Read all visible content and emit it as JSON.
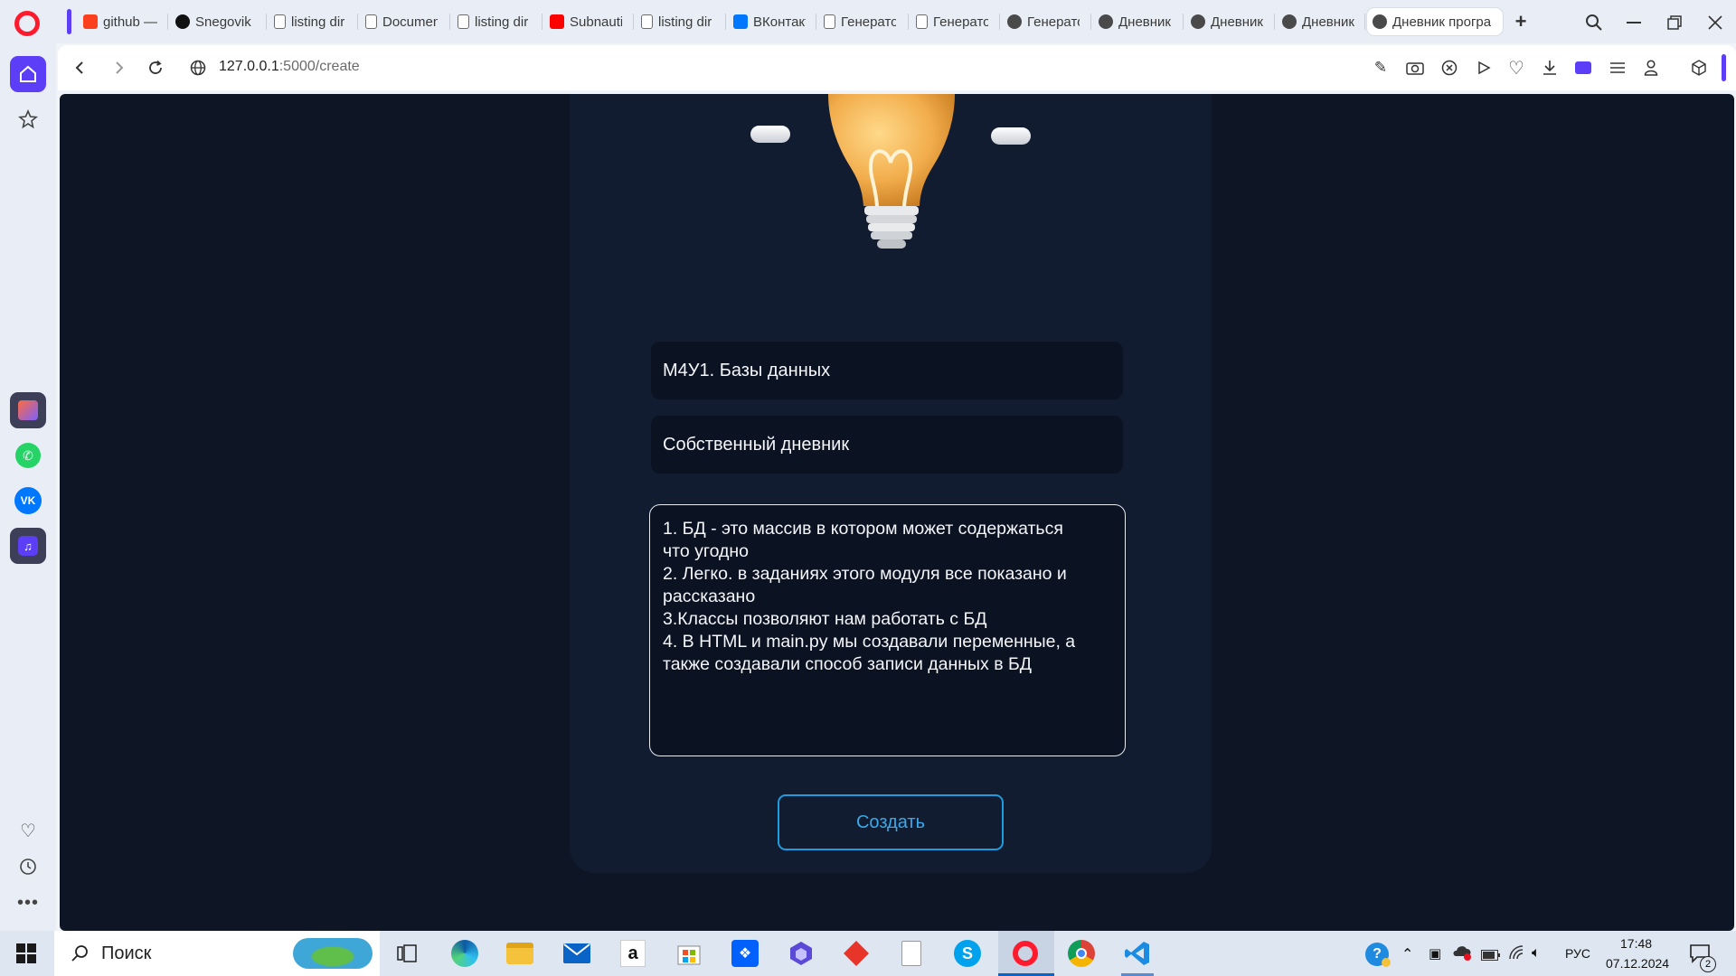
{
  "tabs": [
    {
      "title": "github —",
      "favicon": "yandex-icon",
      "color": "#fc3f1d"
    },
    {
      "title": "Snegovik",
      "favicon": "github-icon",
      "color": "#111111"
    },
    {
      "title": "listing dir",
      "favicon": "document-icon"
    },
    {
      "title": "Documen",
      "favicon": "document-icon"
    },
    {
      "title": "listing dir",
      "favicon": "document-icon"
    },
    {
      "title": "Subnautic",
      "favicon": "youtube-icon",
      "color": "#ff0000"
    },
    {
      "title": "listing dir",
      "favicon": "document-icon"
    },
    {
      "title": "ВКонтакт",
      "favicon": "vk-icon",
      "color": "#0077ff"
    },
    {
      "title": "Генерато",
      "favicon": "document-icon"
    },
    {
      "title": "Генерато",
      "favicon": "document-icon"
    },
    {
      "title": "Генерато",
      "favicon": "globe-icon"
    },
    {
      "title": "Дневник",
      "favicon": "globe-icon"
    },
    {
      "title": "Дневник",
      "favicon": "globe-icon"
    },
    {
      "title": "Дневник",
      "favicon": "globe-icon"
    },
    {
      "title": "Дневник програ",
      "favicon": "globe-icon",
      "active": true
    }
  ],
  "address": {
    "host": "127.0.0.1",
    "path": ":5000/create"
  },
  "form": {
    "title_value": "М4У1. Базы данных",
    "subtitle_value": "Собственный дневник",
    "body_value": "1. БД - это массив в котором может содержаться\nчто угодно\n2. Легко. в заданиях этого модуля все показано и\nрассказано\n3.Классы позволяют нам работать с БД\n4. В HTML и main.py мы создавали переменные, а\nтакже создавали способ записи данных в БД",
    "submit_label": "Создать"
  },
  "taskbar": {
    "search_label": "Поиск",
    "language": "РУС",
    "time": "17:48",
    "date": "07.12.2024",
    "notifications": "2"
  },
  "colors": {
    "page_bg": "#0e1626",
    "card_bg": "#111c30",
    "accent": "#1f9be0",
    "opera_red": "#ff1b2d"
  }
}
